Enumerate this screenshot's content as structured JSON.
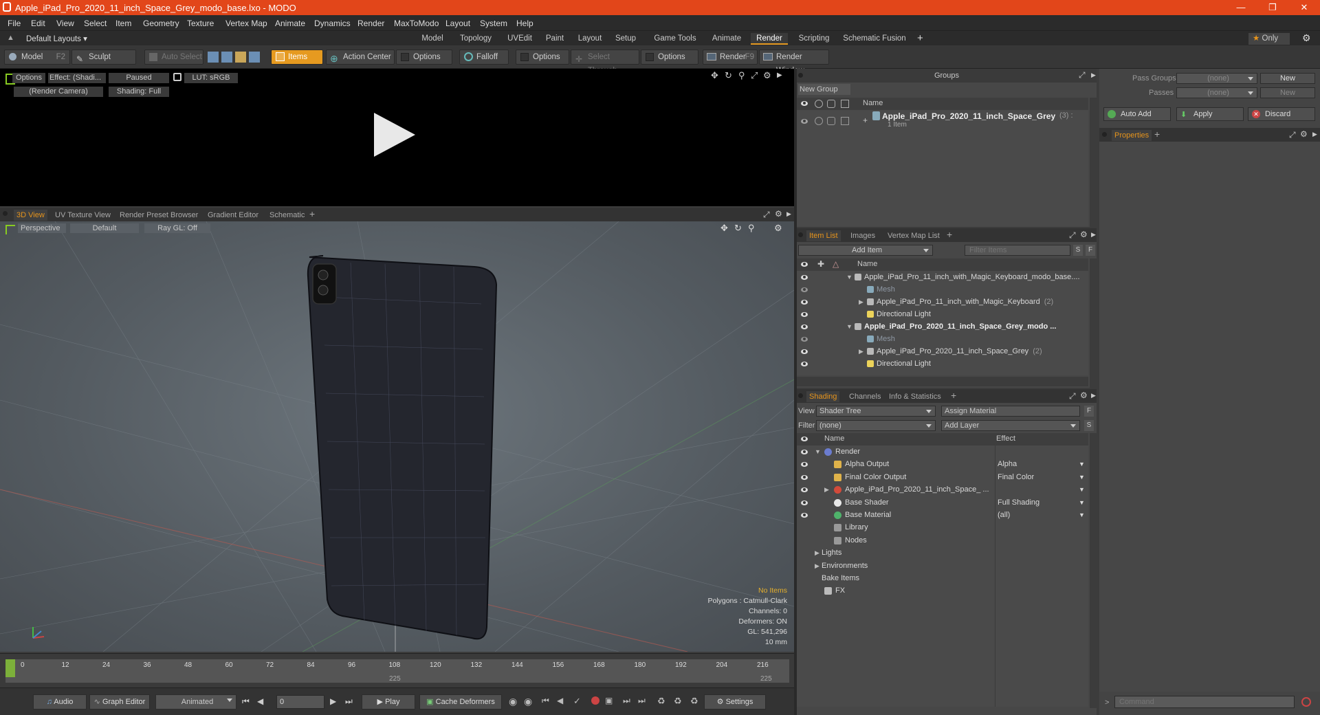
{
  "window": {
    "title": "Apple_iPad_Pro_2020_11_inch_Space_Grey_modo_base.lxo - MODO"
  },
  "menu": [
    "File",
    "Edit",
    "View",
    "Select",
    "Item",
    "Geometry",
    "Texture",
    "Vertex Map",
    "Animate",
    "Dynamics",
    "Render",
    "MaxToModo",
    "Layout",
    "System",
    "Help"
  ],
  "layoutbar": {
    "layouts_label": "Default Layouts",
    "tabs": [
      "Model",
      "Topology",
      "UVEdit",
      "Paint",
      "Layout",
      "Setup",
      "Game Tools",
      "Animate",
      "Render",
      "Scripting",
      "Schematic Fusion"
    ],
    "active_tab": "Render",
    "only_label": "Only"
  },
  "toolbar": {
    "model": "Model",
    "model_key": "F2",
    "sculpt": "Sculpt",
    "auto_select": "Auto Select",
    "items": "Items",
    "action_center": "Action Center",
    "options1": "Options",
    "falloff": "Falloff",
    "options2": "Options",
    "select_through": "Select Through",
    "options3": "Options",
    "render": "Render",
    "render_key": "F9",
    "render_window": "Render Window"
  },
  "render_view": {
    "options": "Options",
    "effect": "Effect: (Shadi...",
    "paused": "Paused",
    "lut": "LUT: sRGB",
    "camera": "(Render Camera)",
    "shading": "Shading: Full"
  },
  "viewport_tabs": [
    "3D View",
    "UV Texture View",
    "Render Preset Browser",
    "Gradient Editor",
    "Schematic"
  ],
  "viewport": {
    "perspective": "Perspective",
    "default": "Default",
    "raygl": "Ray GL: Off",
    "stats": {
      "no_items": "No Items",
      "polygons": "Polygons : Catmull-Clark",
      "channels": "Channels: 0",
      "deformers": "Deformers: ON",
      "gl": "GL: 541,296",
      "units": "10 mm"
    }
  },
  "timeline": {
    "ticks": [
      "0",
      "12",
      "24",
      "36",
      "48",
      "60",
      "72",
      "84",
      "96",
      "108",
      "120",
      "132",
      "144",
      "156",
      "168",
      "180",
      "192",
      "204",
      "216"
    ],
    "sub_ticks": [
      "225",
      "225"
    ]
  },
  "bottombar": {
    "audio": "Audio",
    "graph_editor": "Graph Editor",
    "animated": "Animated",
    "frame": "0",
    "play": "Play",
    "cache": "Cache Deformers",
    "settings": "Settings"
  },
  "groups": {
    "title": "Groups",
    "new_group": "New Group",
    "col_name": "Name",
    "item_name": "Apple_iPad_Pro_2020_11_inch_Space_Grey",
    "item_count": "(3) :",
    "item_sub": "1 Item"
  },
  "pass": {
    "pass_groups": "Pass Groups",
    "passes": "Passes",
    "none1": "(none)",
    "none2": "(none)",
    "new1": "New",
    "new2": "New",
    "auto_add": "Auto Add",
    "apply": "Apply",
    "discard": "Discard",
    "properties": "Properties"
  },
  "itemlist": {
    "tabs": [
      "Item List",
      "Images",
      "Vertex Map List"
    ],
    "add_item": "Add Item",
    "filter": "Filter Items",
    "col_name": "Name",
    "rows": [
      {
        "label": "Apple_iPad_Pro_11_inch_with_Magic_Keyboard_modo_base....",
        "bold": false,
        "indent": 0,
        "dim": false
      },
      {
        "label": "Mesh",
        "bold": false,
        "indent": 1,
        "dim": true
      },
      {
        "label": "Apple_iPad_Pro_11_inch_with_Magic_Keyboard",
        "count": "(2)",
        "bold": false,
        "indent": 1,
        "dim": false
      },
      {
        "label": "Directional Light",
        "bold": false,
        "indent": 1,
        "dim": false
      },
      {
        "label": "Apple_iPad_Pro_2020_11_inch_Space_Grey_modo ...",
        "bold": true,
        "indent": 0,
        "dim": false
      },
      {
        "label": "Mesh",
        "bold": false,
        "indent": 1,
        "dim": true
      },
      {
        "label": "Apple_iPad_Pro_2020_11_inch_Space_Grey",
        "count": "(2)",
        "bold": false,
        "indent": 1,
        "dim": false
      },
      {
        "label": "Directional Light",
        "bold": false,
        "indent": 1,
        "dim": false
      }
    ]
  },
  "shading": {
    "tabs": [
      "Shading",
      "Channels",
      "Info & Statistics"
    ],
    "view_label": "View",
    "view_value": "Shader Tree",
    "assign": "Assign Material",
    "filter_label": "Filter",
    "filter_value": "(none)",
    "add_layer": "Add Layer",
    "col_name": "Name",
    "col_effect": "Effect",
    "rows": [
      {
        "label": "Render",
        "effect": ""
      },
      {
        "label": "Alpha Output",
        "effect": "Alpha"
      },
      {
        "label": "Final Color Output",
        "effect": "Final Color"
      },
      {
        "label": "Apple_iPad_Pro_2020_11_inch_Space_ ...",
        "effect": ""
      },
      {
        "label": "Base Shader",
        "effect": "Full Shading"
      },
      {
        "label": "Base Material",
        "effect": "(all)"
      },
      {
        "label": "Library",
        "effect": ""
      },
      {
        "label": "Nodes",
        "effect": ""
      },
      {
        "label": "Lights",
        "effect": ""
      },
      {
        "label": "Environments",
        "effect": ""
      },
      {
        "label": "Bake Items",
        "effect": ""
      },
      {
        "label": "FX",
        "effect": ""
      }
    ]
  },
  "command": {
    "placeholder": "Command"
  }
}
